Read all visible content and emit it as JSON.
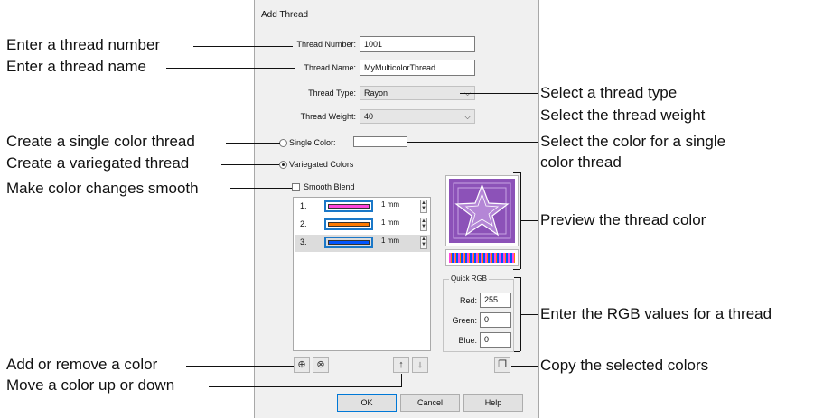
{
  "callouts": {
    "thread_number": "Enter a thread number",
    "thread_name": "Enter a thread name",
    "thread_type": "Select a thread type",
    "thread_weight": "Select the thread weight",
    "single_color": "Create a single color thread",
    "variegated": "Create a variegated thread",
    "color_single_1": "Select the color for a single",
    "color_single_2": "color thread",
    "smooth": "Make color changes smooth",
    "preview": "Preview the thread color",
    "rgb": "Enter the RGB values for a thread",
    "add_remove": "Add or remove a color",
    "copy": "Copy the selected colors",
    "move": "Move a color up or down"
  },
  "dialog": {
    "title": "Add Thread",
    "thread_number_label": "Thread Number:",
    "thread_number_value": "1001",
    "thread_name_label": "Thread Name:",
    "thread_name_value": "MyMulticolorThread",
    "thread_type_label": "Thread Type:",
    "thread_type_value": "Rayon",
    "thread_weight_label": "Thread Weight:",
    "thread_weight_value": "40",
    "single_color_label": "Single Color:",
    "variegated_label": "Variegated Colors",
    "smooth_blend_label": "Smooth Blend",
    "colors": [
      {
        "num": "1.",
        "color": "#ff44dd",
        "length": "1 mm"
      },
      {
        "num": "2.",
        "color": "#ff7a00",
        "length": "1 mm"
      },
      {
        "num": "3.",
        "color": "#0055ff",
        "length": "1 mm"
      }
    ],
    "quick_rgb_label": "Quick RGB",
    "red_label": "Red:",
    "red_value": "255",
    "green_label": "Green:",
    "green_value": "0",
    "blue_label": "Blue:",
    "blue_value": "0",
    "ok": "OK",
    "cancel": "Cancel",
    "help": "Help"
  },
  "icons": {
    "add_color": "add-color-icon",
    "remove_color": "remove-color-icon",
    "move_up": "arrow-up-icon",
    "move_down": "arrow-down-icon",
    "copy": "copy-icon",
    "dropdown": "chevron-down-icon"
  },
  "colors": {
    "preview_purple": "#8c52b8",
    "row_selected": "#dcdcdc"
  }
}
